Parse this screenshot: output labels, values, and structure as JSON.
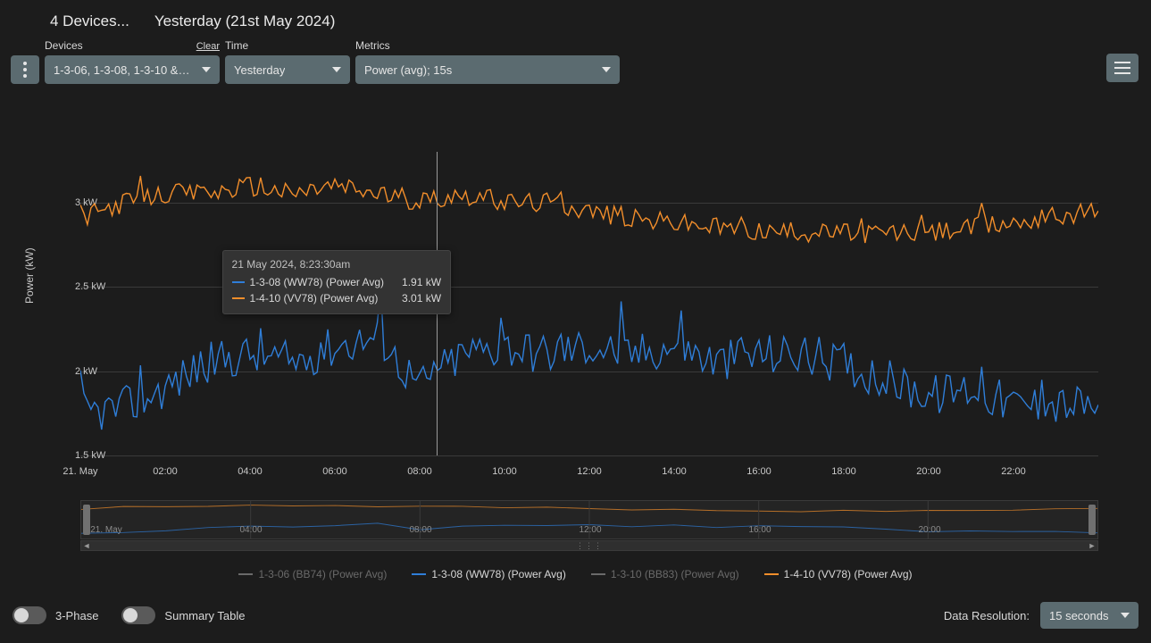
{
  "header": {
    "device_count_label": "4 Devices...",
    "date_label": "Yesterday (21st May 2024)"
  },
  "filters": {
    "devices_label": "Devices",
    "devices_clear": "Clear",
    "devices_value": "1-3-06, 1-3-08, 1-3-10 & 1-…",
    "time_label": "Time",
    "time_value": "Yesterday",
    "metrics_label": "Metrics",
    "metrics_value": "Power (avg); 15s"
  },
  "axis": {
    "y_title": "Power (kW)",
    "y_ticks": [
      "1.5 kW",
      "2 kW",
      "2.5 kW",
      "3 kW"
    ],
    "x_ticks": [
      "21. May",
      "02:00",
      "04:00",
      "06:00",
      "08:00",
      "10:00",
      "12:00",
      "14:00",
      "16:00",
      "18:00",
      "20:00",
      "22:00"
    ]
  },
  "tooltip": {
    "time": "21 May 2024, 8:23:30am",
    "rows": [
      {
        "color": "#2f7ed8",
        "label": "1-3-08 (WW78) (Power Avg)",
        "value": "1.91 kW"
      },
      {
        "color": "#f28e2b",
        "label": "1-4-10 (VV78) (Power Avg)",
        "value": "3.01 kW"
      }
    ]
  },
  "legend": [
    {
      "label": "1-3-06 (BB74) (Power Avg)",
      "color": "#8a8a8a",
      "active": false
    },
    {
      "label": "1-3-08 (WW78) (Power Avg)",
      "color": "#2f7ed8",
      "active": true
    },
    {
      "label": "1-3-10 (BB83) (Power Avg)",
      "color": "#8a8a8a",
      "active": false
    },
    {
      "label": "1-4-10 (VV78) (Power Avg)",
      "color": "#f28e2b",
      "active": true
    }
  ],
  "navigator_ticks": [
    "21. May",
    "04:00",
    "08:00",
    "12:00",
    "16:00",
    "20:00"
  ],
  "footer": {
    "toggle_3phase": "3-Phase",
    "toggle_summary": "Summary Table",
    "resolution_label": "Data Resolution:",
    "resolution_value": "15 seconds"
  },
  "chart_data": {
    "type": "line",
    "xlabel": "",
    "ylabel": "Power (kW)",
    "ylim": [
      1.5,
      3.3
    ],
    "x_hours": [
      0,
      1,
      2,
      3,
      4,
      5,
      6,
      7,
      8,
      9,
      10,
      11,
      12,
      13,
      14,
      15,
      16,
      17,
      18,
      19,
      20,
      21,
      22,
      23,
      24
    ],
    "series": [
      {
        "name": "1-3-08 (WW78) (Power Avg)",
        "color": "#2f7ed8",
        "unit": "kW",
        "values": [
          1.75,
          1.78,
          1.9,
          2.05,
          2.1,
          2.05,
          2.15,
          2.2,
          1.91,
          2.1,
          2.15,
          2.1,
          2.15,
          2.1,
          2.15,
          2.05,
          2.1,
          2.1,
          2.05,
          1.95,
          1.85,
          1.9,
          1.8,
          1.8,
          1.8
        ]
      },
      {
        "name": "1-4-10 (VV78) (Power Avg)",
        "color": "#f28e2b",
        "unit": "kW",
        "values": [
          2.9,
          3.0,
          3.05,
          3.05,
          3.1,
          3.05,
          3.1,
          3.05,
          3.01,
          3.05,
          3.0,
          3.0,
          2.95,
          2.9,
          2.88,
          2.85,
          2.83,
          2.82,
          2.82,
          2.82,
          2.82,
          2.85,
          2.88,
          2.92,
          2.95
        ]
      }
    ],
    "cursor_hour": 8.39
  }
}
